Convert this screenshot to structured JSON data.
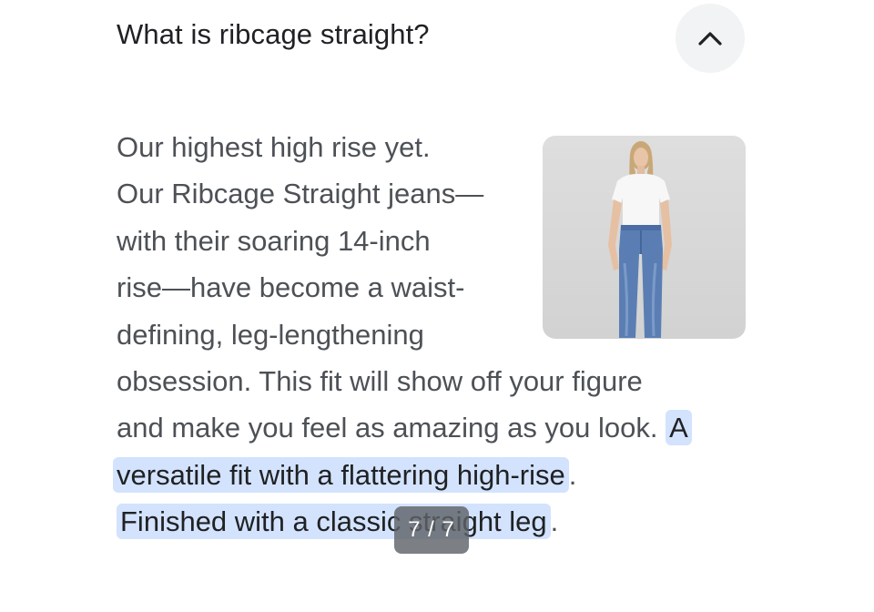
{
  "question": "What is ribcage straight?",
  "collapse_icon": "chevron-up-icon",
  "answer": {
    "lines": [
      "Our highest high rise yet.",
      "Our Ribcage Straight jeans—",
      "with their soaring 14-inch",
      "rise—have become a waist-",
      "defining, leg-lengthening",
      "obsession. This fit will show off your figure"
    ],
    "line7_plain": "and make you feel as amazing as you look. ",
    "line7_highlight": "A",
    "line8_highlight": "versatile fit with a flattering high-rise",
    "line8_after": ".",
    "line9_highlight": "Finished with a classic straight leg",
    "line9_after": "."
  },
  "image_alt": "Woman wearing white t-shirt and high-rise straight jeans",
  "counter": "7 / 7",
  "colors": {
    "highlight": "#d3e3fd",
    "text": "#4d5156",
    "heading": "#202124"
  }
}
